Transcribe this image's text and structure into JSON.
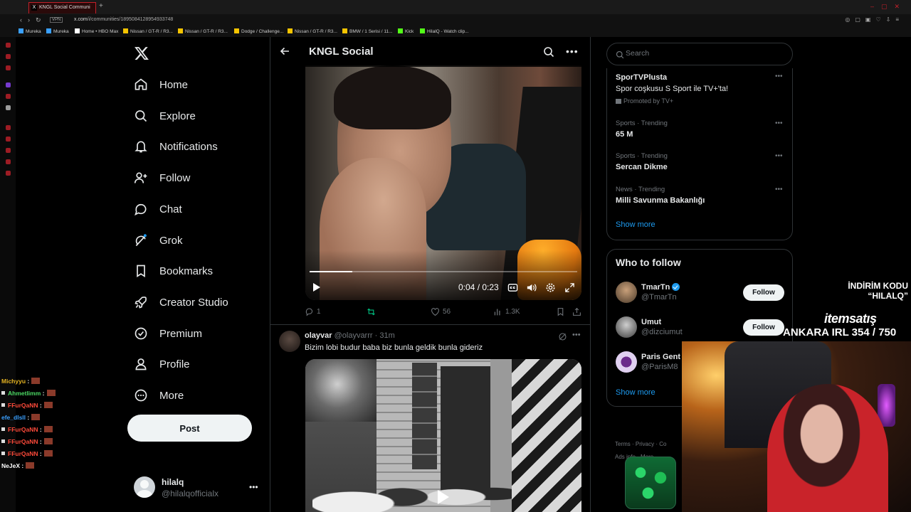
{
  "browser": {
    "tab_title": "KNGL Social Communi",
    "url_prefix": "x.com",
    "url_path": "/i/communities/1895084128954933748",
    "vpn": "VPN",
    "bookmarks": [
      "Mureka",
      "Mureka",
      "Home • HBO Max",
      "Nissan / GT-R / R3...",
      "Nissan / GT-R / R3...",
      "Dodge / Challenge...",
      "Nissan / GT-R / R3...",
      "BMW / 1 Serisi / 11...",
      "Kick",
      "HilalQ - Watch clip..."
    ]
  },
  "nav": {
    "items": [
      {
        "label": "Home",
        "icon": "home-icon"
      },
      {
        "label": "Explore",
        "icon": "search-icon"
      },
      {
        "label": "Notifications",
        "icon": "bell-icon"
      },
      {
        "label": "Follow",
        "icon": "person-add-icon"
      },
      {
        "label": "Chat",
        "icon": "chat-bubble-icon"
      },
      {
        "label": "Grok",
        "icon": "grok-icon"
      },
      {
        "label": "Bookmarks",
        "icon": "bookmark-icon"
      },
      {
        "label": "Creator Studio",
        "icon": "rocket-icon"
      },
      {
        "label": "Premium",
        "icon": "verified-badge-icon"
      },
      {
        "label": "Profile",
        "icon": "person-icon"
      },
      {
        "label": "More",
        "icon": "more-circle-icon"
      }
    ],
    "post_label": "Post",
    "account": {
      "name": "hilalq",
      "handle": "@hilalqofficialx"
    }
  },
  "chat": [
    {
      "user": "Michyyu",
      "color": "#e6b422"
    },
    {
      "user": "Ahmetlimm",
      "color": "#4cd964"
    },
    {
      "user": "FFurQaNN",
      "color": "#ff4a3a"
    },
    {
      "user": "efe_dlsll",
      "color": "#3aa0ff"
    },
    {
      "user": "FFurQaNN",
      "color": "#ff4a3a"
    },
    {
      "user": "FFurQaNN",
      "color": "#ff4a3a"
    },
    {
      "user": "FFurQaNN",
      "color": "#ff4a3a"
    },
    {
      "user": "NeJeX",
      "color": "#ffffff"
    }
  ],
  "header": {
    "title": "KNGL Social"
  },
  "video1": {
    "time": "0:04 / 0:23",
    "progress": 0.16
  },
  "tweet1_actions": {
    "replies": "1",
    "likes": "56",
    "views": "1.3K"
  },
  "tweet2": {
    "name": "olayvar",
    "handle": "@olayvarrr",
    "time": "· 31m",
    "text": "Bizim lobi budur baba biz bunla geldik bunla gideriz"
  },
  "search": {
    "placeholder": "Search"
  },
  "promo": {
    "title": "SporTVPlusta",
    "desc": "Spor coşkusu S Sport ile TV+'ta!",
    "by": "Promoted by TV+"
  },
  "trends": [
    {
      "context": "Sports · Trending",
      "name": "65 M"
    },
    {
      "context": "Sports · Trending",
      "name": "Sercan Dikme"
    },
    {
      "context": "News · Trending",
      "name": "Milli Savunma Bakanlığı"
    }
  ],
  "show_more": "Show more",
  "who_to_follow": {
    "title": "Who to follow",
    "follow_label": "Follow",
    "users": [
      {
        "name": "TmarTn",
        "handle": "@TmarTn",
        "verified": true
      },
      {
        "name": "Umut",
        "handle": "@dizciumut",
        "verified": false
      },
      {
        "name": "Paris Gent",
        "handle": "@ParisM8",
        "verified": false
      }
    ]
  },
  "footer": {
    "line1": "Terms ·   Privacy ·   Co",
    "line2": "Ads info ·   More ···"
  },
  "overlay": {
    "code_label": "İNDİRİM KODU",
    "code": "“HILALQ”",
    "brand": "itemsatış",
    "irl": "ANKARA IRL 354 / 750"
  },
  "colors": {
    "accent": "#1d9bf0",
    "bg": "#000000",
    "border": "#2f3336",
    "muted": "#71767b"
  }
}
